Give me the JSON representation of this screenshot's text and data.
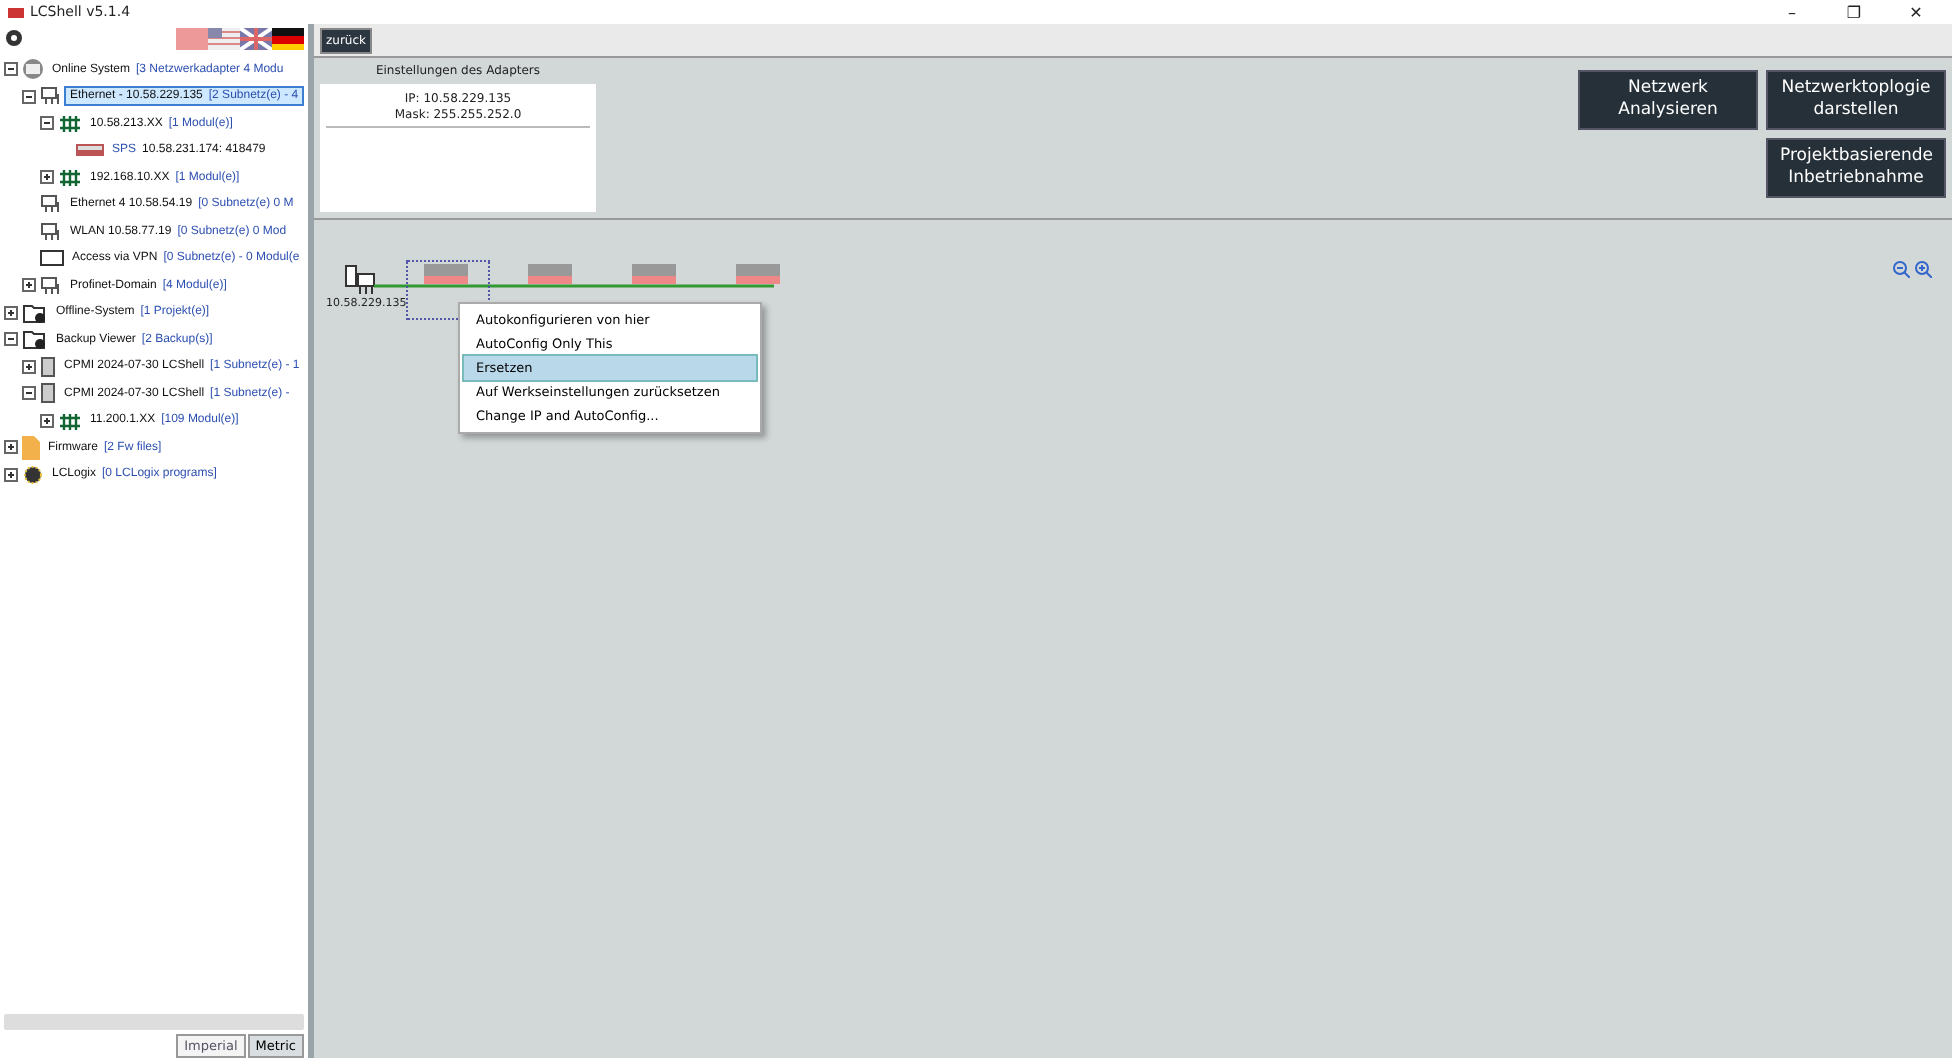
{
  "window": {
    "title": "LCShell v5.1.4",
    "controls": [
      "–",
      "❐",
      "✕"
    ]
  },
  "sidebar": {
    "tree": [
      {
        "kind": "system",
        "label": "Online System",
        "detail": "[3 Netzwerkadapter  4 Modu",
        "expanded": true,
        "selected": false,
        "children": [
          {
            "kind": "adapter",
            "label": "Ethernet - 10.58.229.135",
            "detail": "[2 Subnetz(e) - 4",
            "expanded": true,
            "selected": true,
            "children": [
              {
                "kind": "switch",
                "label": "10.58.213.XX",
                "detail": "[1 Modul(e)]",
                "expanded": true,
                "selected": false,
                "children": [
                  {
                    "kind": "plc",
                    "tag": "SPS",
                    "label": "10.58.231.174: 418479",
                    "selected": false
                  }
                ]
              },
              {
                "kind": "switch",
                "label": "192.168.10.XX",
                "detail": "[1 Modul(e)]",
                "expanded": false,
                "selected": false
              }
            ]
          },
          {
            "kind": "adapter",
            "label": "Ethernet 4   10.58.54.19",
            "detail": "[0 Subnetz(e)   0 M",
            "selected": false
          },
          {
            "kind": "adapter",
            "label": "WLAN   10.58.77.19",
            "detail": "[0 Subnetz(e)   0 Mod",
            "selected": false
          },
          {
            "kind": "vpn",
            "label": "Access via VPN",
            "detail": "[0 Subnetz(e) - 0 Modul(e",
            "selected": false
          },
          {
            "kind": "adapter",
            "label": "Profinet-Domain",
            "detail": "[4 Modul(e)]",
            "expanded": false,
            "selected": false
          }
        ]
      },
      {
        "kind": "folder",
        "label": "Offline-System",
        "detail": "[1 Projekt(e)]",
        "expanded": false,
        "selected": false
      },
      {
        "kind": "folder",
        "label": "Backup Viewer",
        "detail": "[2 Backup(s)]",
        "expanded": true,
        "selected": false,
        "children": [
          {
            "kind": "backup",
            "label": "CPMI 2024-07-30 LCShell",
            "detail": "[1 Subnetz(e) - 1",
            "expanded": false,
            "selected": false
          },
          {
            "kind": "backup",
            "label": "CPMI 2024-07-30 LCShell",
            "detail": "[1 Subnetz(e) -",
            "expanded": true,
            "selected": false,
            "children": [
              {
                "kind": "switch",
                "label": "11.200.1.XX",
                "detail": "[109 Modul(e)]",
                "expanded": false,
                "selected": false
              }
            ]
          }
        ]
      },
      {
        "kind": "firmware",
        "label": "Firmware",
        "detail": "[2 Fw files]",
        "expanded": false,
        "selected": false
      },
      {
        "kind": "logix",
        "label": "LCLogix",
        "detail": "[0 LCLogix programs]",
        "expanded": false,
        "selected": false
      }
    ],
    "units": [
      {
        "label": "Imperial",
        "selected": false
      },
      {
        "label": "Metric",
        "selected": true
      }
    ]
  },
  "toolbar": {
    "back": "zurück"
  },
  "adapter_settings": {
    "title": "Einstellungen des Adapters",
    "ip": "IP: 10.58.229.135",
    "mask": "Mask: 255.255.252.0"
  },
  "actions": [
    "Netzwerk\nAnalysieren",
    "Netzwerktoplogie\ndarstellen",
    "Projektbasierende\nInbetriebnahme"
  ],
  "canvas": {
    "pc_label": "10.58.229.135"
  },
  "context_menu": [
    {
      "label": "Autokonfigurieren von hier",
      "selected": false
    },
    {
      "label": "AutoConfig Only This",
      "selected": false
    },
    {
      "label": "Ersetzen",
      "selected": true
    },
    {
      "label": "Auf Werkseinstellungen zurücksetzen",
      "selected": false
    },
    {
      "label": "Change IP and AutoConfig...",
      "selected": false
    }
  ]
}
